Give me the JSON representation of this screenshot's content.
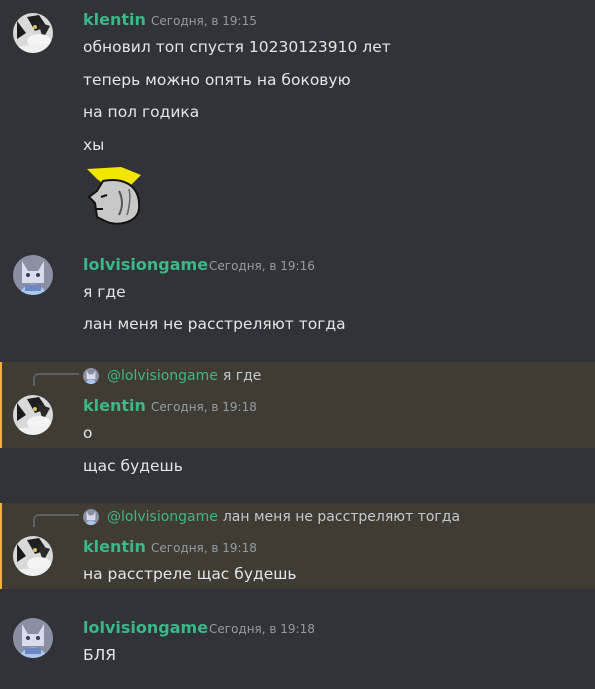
{
  "colors": {
    "background": "#313338",
    "highlight": "#403c34",
    "mention_bar": "#f0b232",
    "author_green": "#3ab888",
    "timestamp": "#949ba4",
    "text": "#e3e5e8"
  },
  "messages": {
    "m1": {
      "author": "klentin",
      "avatar_icon": "cat-avatar-icon",
      "timestamp": "Сегодня, в 19:15",
      "lines": [
        "обновил топ спустя 10230123910 лет",
        "теперь можно опять на боковую",
        "на пол годика",
        "хы"
      ],
      "emoji_icon": "gigachad-emoji-icon"
    },
    "m2": {
      "author": "lolvisiongame",
      "avatar_icon": "cat-avatar-icon",
      "timestamp": "Сегодня, в 19:16",
      "lines": [
        "я где",
        "лан меня не расстреляют тогда"
      ]
    },
    "m3": {
      "reply_to_user": "@lolvisiongame",
      "reply_to_text": "я где",
      "author": "klentin",
      "timestamp": "Сегодня, в 19:18",
      "lines": [
        "о",
        "щас будешь"
      ]
    },
    "m4": {
      "reply_to_user": "@lolvisiongame",
      "reply_to_text": "лан меня не расстреляют тогда",
      "author": "klentin",
      "timestamp": "Сегодня, в 19:18",
      "lines": [
        "на расстреле щас будешь"
      ]
    },
    "m5": {
      "author": "lolvisiongame",
      "timestamp": "Сегодня, в 19:18",
      "lines": [
        "БЛЯ"
      ]
    }
  }
}
